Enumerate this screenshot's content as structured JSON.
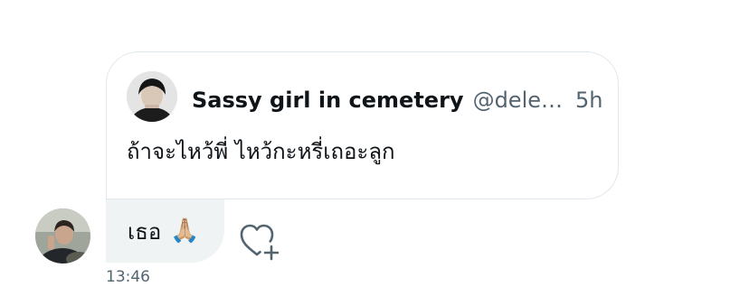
{
  "quote": {
    "author_name": "Sassy girl in cemetery",
    "author_handle": "@dele…",
    "time": "5h",
    "text": "ถ้าจะไหว้พี่ ไหว้กะหรี่เถอะลูก"
  },
  "reply": {
    "text": "เธอ",
    "emoji": "🙏🏼"
  },
  "timestamp": "13:46",
  "icons": {
    "like": "heart-plus-icon"
  },
  "colors": {
    "text_primary": "#0f1419",
    "text_secondary": "#536471",
    "card_border": "#e1e8ed",
    "bubble_bg": "#eff3f4"
  }
}
